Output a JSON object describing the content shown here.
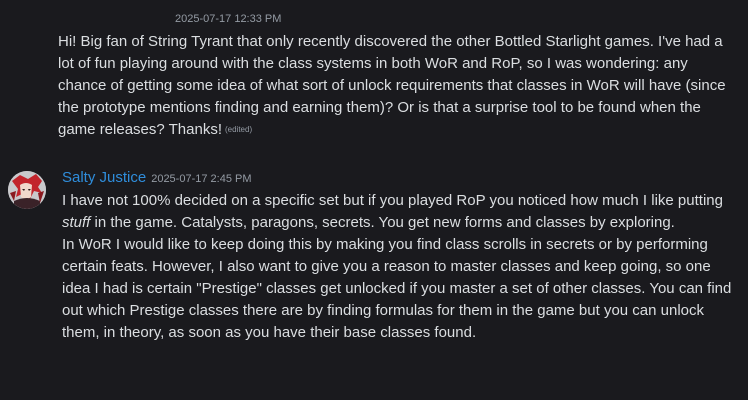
{
  "messages": [
    {
      "timestamp": "2025-07-17 12:33 PM",
      "text": "Hi! Big fan of String Tyrant that only recently discovered the other Bottled Starlight games. I've had a lot of fun playing around with the class systems in both WoR and RoP, so I was wondering: any chance of getting some idea of what sort of unlock requirements that classes in WoR will have (since the prototype mentions finding and earning them)? Or is that a surprise tool to be found when the game releases? Thanks!",
      "edited_label": "(edited)"
    },
    {
      "author": "Salty Justice",
      "author_color": "#2f8ddb",
      "timestamp": "2025-07-17 2:45 PM",
      "para1_before": "I have not 100% decided on a specific set but if you played RoP you noticed how much I like putting ",
      "para1_em": "stuff",
      "para1_after": " in the game. Catalysts, paragons, secrets. You get new forms and classes by exploring.",
      "para2": "In WoR I would like to keep doing this by making you find class scrolls in secrets or by performing certain feats. However, I also want to give you a reason to master classes and keep going, so one idea I had is certain \"Prestige\" classes get unlocked if you master a set of other classes. You can find out which Prestige classes there are by finding formulas for them in the game but you can unlock them, in theory, as soon as you have their base classes found."
    }
  ],
  "colors": {
    "background": "#1a1a1e",
    "text": "#dbdee1",
    "muted": "#949ba4"
  },
  "icons": {
    "avatar": "red-haired-character-avatar"
  }
}
